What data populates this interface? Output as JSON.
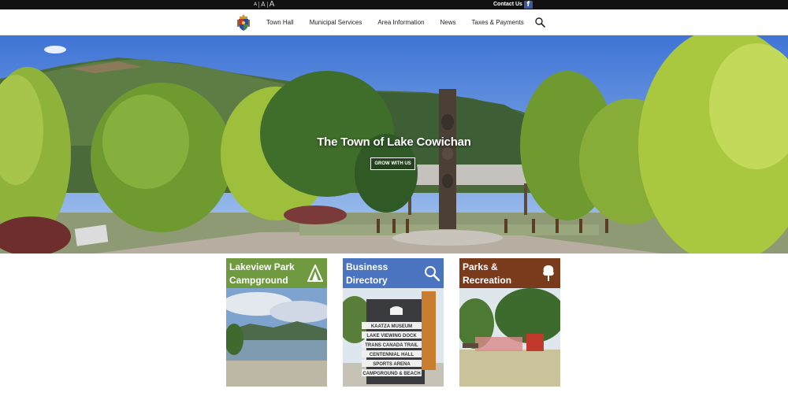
{
  "topbar": {
    "font_sizes": [
      "A",
      "A",
      "A"
    ],
    "contact_label": "Contact Us",
    "facebook_glyph": "f",
    "facebook_color": "#3b5998"
  },
  "nav": {
    "logo_icon": "town-crest-icon",
    "items": [
      "Town Hall",
      "Municipal Services",
      "Area Information",
      "News",
      "Taxes & Payments"
    ],
    "search_icon": "search-icon"
  },
  "hero": {
    "title": "The Town of Lake Cowichan",
    "button_label": "GROW WITH US"
  },
  "cards": [
    {
      "title_line1": "Lakeview Park",
      "title_line2": "Campground",
      "icon": "tent-icon",
      "color": "#6f9a3f"
    },
    {
      "title_line1": "Business",
      "title_line2": "Directory",
      "icon": "search-icon",
      "color": "#4a73c0"
    },
    {
      "title_line1": "Parks &",
      "title_line2": "Recreation",
      "icon": "tree-icon",
      "color": "#7a3b1d"
    }
  ],
  "signpost": {
    "labels": [
      "KAATZA MUSEUM",
      "LAKE VIEWING DOCK",
      "TRANS CANADA TRAIL",
      "CENTENNIAL HALL",
      "SPORTS ARENA",
      "CAMPGROUND & BEACH"
    ]
  }
}
